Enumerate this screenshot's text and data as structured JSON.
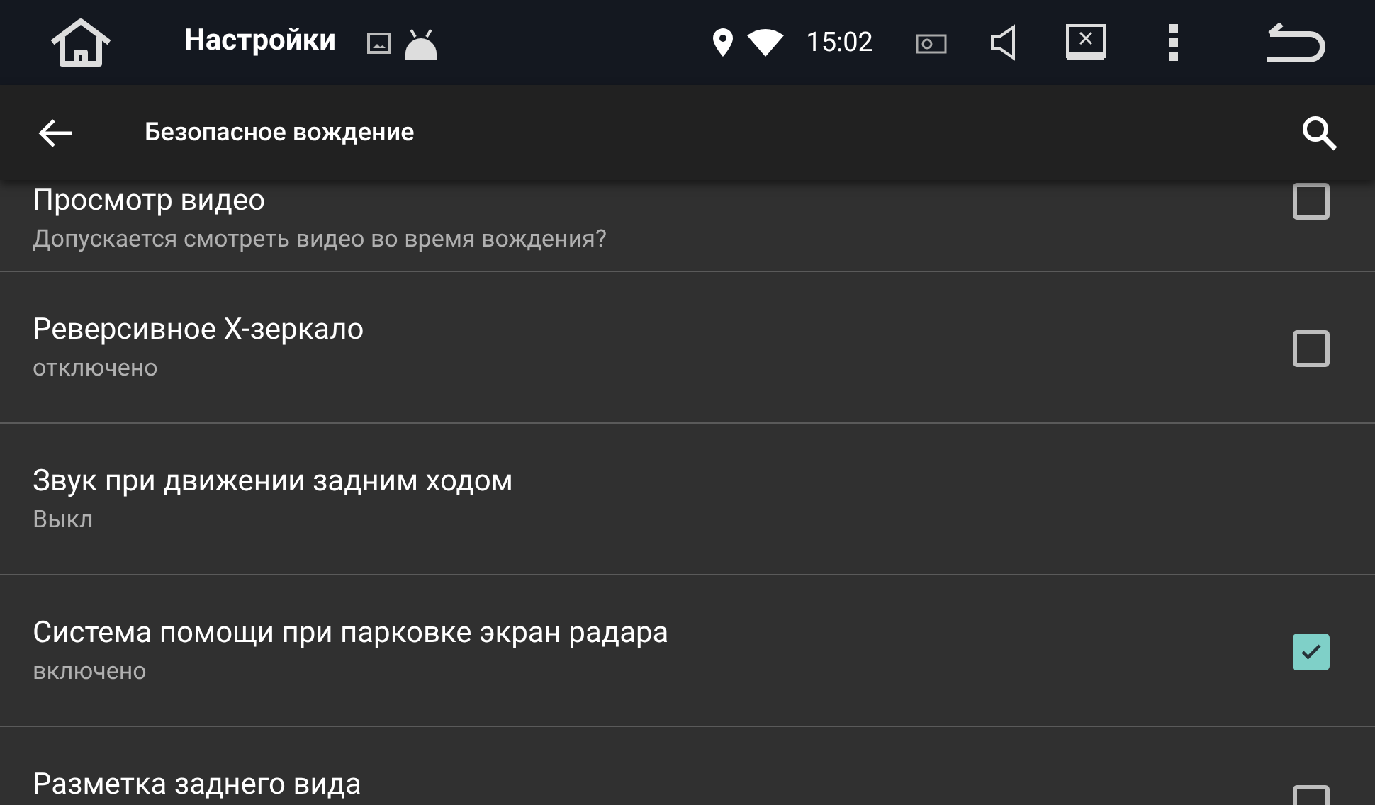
{
  "status_bar": {
    "app_title": "Настройки",
    "time": "15:02"
  },
  "toolbar": {
    "title": "Безопасное вождение"
  },
  "settings": [
    {
      "kind": "checkbox",
      "title": "Просмотр видео",
      "summary": "Допускается смотреть видео во время вождения?",
      "checked": false
    },
    {
      "kind": "checkbox",
      "title": "Реверсивное X-зеркало",
      "summary": "отключено",
      "checked": false
    },
    {
      "kind": "text",
      "title": "Звук при движении задним ходом",
      "summary": "Выкл"
    },
    {
      "kind": "checkbox",
      "title": "Система помощи при парковке экран радара",
      "summary": "включено",
      "checked": true
    },
    {
      "kind": "checkbox",
      "title": "Разметка заднего вида",
      "checked": false
    }
  ]
}
